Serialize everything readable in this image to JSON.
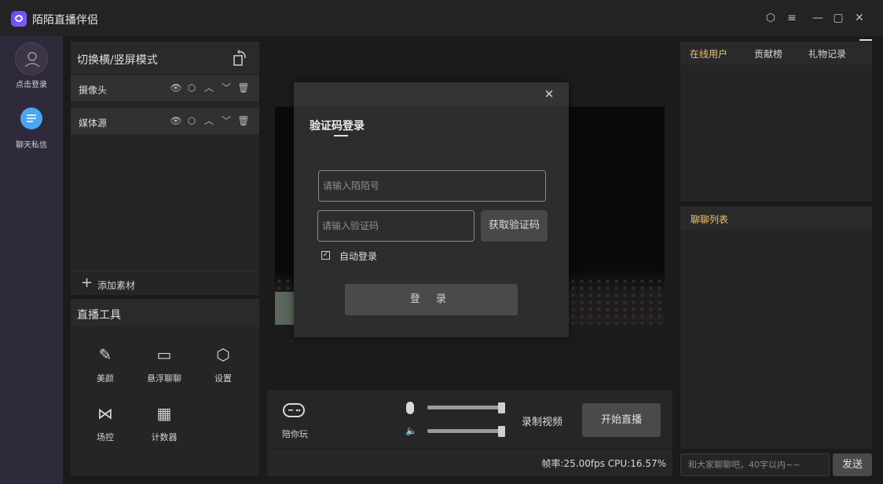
{
  "app": {
    "title": "陌陌直播伴侣"
  },
  "titlebar": {
    "settings_icon": "⬡",
    "menu_icon": "≡",
    "minimize_icon": "—",
    "maximize_icon": "▢",
    "close_icon": "✕"
  },
  "rail": {
    "login_label": "点击登录",
    "chat_label": "聊天私信"
  },
  "scene": {
    "title": "切换横/竖屏模式",
    "sources": [
      {
        "label": "摄像头"
      },
      {
        "label": "媒体源"
      }
    ],
    "add_label": "添加素材"
  },
  "tools": {
    "title": "直播工具",
    "items": [
      {
        "label": "美颜",
        "icon": "✎"
      },
      {
        "label": "悬浮聊聊",
        "icon": "▭"
      },
      {
        "label": "设置",
        "icon": "⬡"
      },
      {
        "label": "场控",
        "icon": "⋈"
      },
      {
        "label": "计数器",
        "icon": "▦"
      }
    ]
  },
  "dialog": {
    "title": "验证码登录",
    "momo_id_placeholder": "请输入陌陌号",
    "code_placeholder": "请输入验证码",
    "get_code_label": "获取验证码",
    "auto_login_label": "自动登录",
    "auto_login_checked": true,
    "login_label": "登 录"
  },
  "controls": {
    "game_label": "陪你玩",
    "mic_level": 1.0,
    "speaker_level": 1.0,
    "record_label": "录制视频",
    "start_label": "开始直播",
    "stats": "帧率:25.00fps  CPU:16.57%"
  },
  "right": {
    "tabs": [
      {
        "label": "在线用户",
        "active": true
      },
      {
        "label": "贡献榜",
        "active": false
      },
      {
        "label": "礼物记录",
        "active": false
      }
    ],
    "chat_title": "聊聊列表",
    "chat_placeholder": "和大家聊聊吧，40字以内~~",
    "send_label": "发送"
  },
  "colors": {
    "accent_tab": "#f0c36b",
    "rail_bg": "#2f2a3b",
    "chat_icon_bg": "#4aa6f2"
  }
}
